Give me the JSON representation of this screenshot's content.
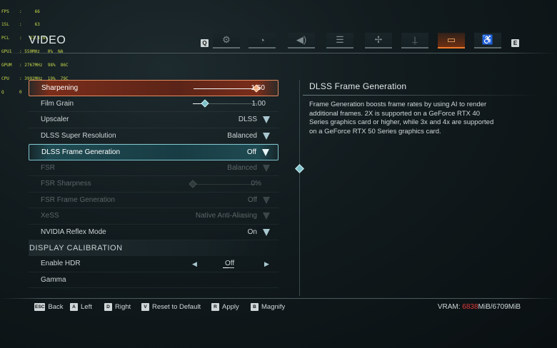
{
  "overlay": [
    {
      "k": "FPS",
      "v": ":     66"
    },
    {
      "k": "15L",
      "v": ":     63"
    },
    {
      "k": "PCL",
      "v": ":   47.8 ms"
    },
    {
      "k": "GPU1",
      "v": ": 550MHz   0%  NA"
    },
    {
      "k": "GPUM",
      "v": ": 2767MHz  98%  86C"
    },
    {
      "k": "CPU",
      "v": ": 3992MHz  19%  79C"
    },
    {
      "k": "Q",
      "v": "0"
    }
  ],
  "header": {
    "title": "VIDEO",
    "prev_key": "Q",
    "next_key": "E",
    "tabs": [
      {
        "icon": "gears-icon",
        "glyph": "⚙"
      },
      {
        "icon": "performance-icon",
        "glyph": "◔"
      },
      {
        "icon": "audio-icon",
        "glyph": "◀)"
      },
      {
        "icon": "list-icon",
        "glyph": "☰"
      },
      {
        "icon": "controls-icon",
        "glyph": "✢"
      },
      {
        "icon": "joystick-icon",
        "glyph": "⍊"
      },
      {
        "icon": "display-icon",
        "glyph": "▭"
      },
      {
        "icon": "accessibility-icon",
        "glyph": "♿"
      }
    ],
    "active_tab": 6
  },
  "settings": {
    "sharpening": {
      "label": "Sharpening",
      "value": "1.50",
      "level": 1.0
    },
    "film_grain": {
      "label": "Film Grain",
      "value": "1.00",
      "level": 0.19
    },
    "upscaler": {
      "label": "Upscaler",
      "value": "DLSS"
    },
    "dlss_sr": {
      "label": "DLSS Super Resolution",
      "value": "Balanced"
    },
    "dlss_fg": {
      "label": "DLSS Frame Generation",
      "value": "Off"
    },
    "fsr": {
      "label": "FSR",
      "value": "Balanced"
    },
    "fsr_sharpness": {
      "label": "FSR Sharpness",
      "value": "0%",
      "level": 0.0
    },
    "fsr_fg": {
      "label": "FSR Frame Generation",
      "value": "Off"
    },
    "xess": {
      "label": "XeSS",
      "value": "Native Anti-Aliasing"
    },
    "reflex": {
      "label": "NVIDIA Reflex Mode",
      "value": "On"
    },
    "section_display": "DISPLAY CALIBRATION",
    "hdr": {
      "label": "Enable HDR",
      "value": "Off"
    },
    "gamma": {
      "label": "Gamma"
    }
  },
  "description": {
    "title": "DLSS Frame Generation",
    "body": "Frame Generation boosts frame rates by using AI to render additional frames. 2X is supported on a GeForce RTX 40 Series graphics card or higher, while 3x and 4x are supported on a GeForce RTX 50 Series graphics card."
  },
  "footer": {
    "hints": [
      {
        "key": "ESC",
        "label": "Back"
      },
      {
        "key": "A",
        "label": "Left"
      },
      {
        "key": "D",
        "label": "Right"
      },
      {
        "key": "V",
        "label": "Reset to Default"
      },
      {
        "key": "R",
        "label": "Apply"
      },
      {
        "key": "B",
        "label": "Magnify"
      }
    ],
    "vram_label": "VRAM: ",
    "vram_used": "6838",
    "vram_rest": "MiB/6709MiB"
  },
  "colors": {
    "accent_orange": "#f07a2c",
    "accent_teal": "#7cc1c9",
    "vram_warning": "#e03a3a",
    "overlay_text": "#c8d84a"
  }
}
